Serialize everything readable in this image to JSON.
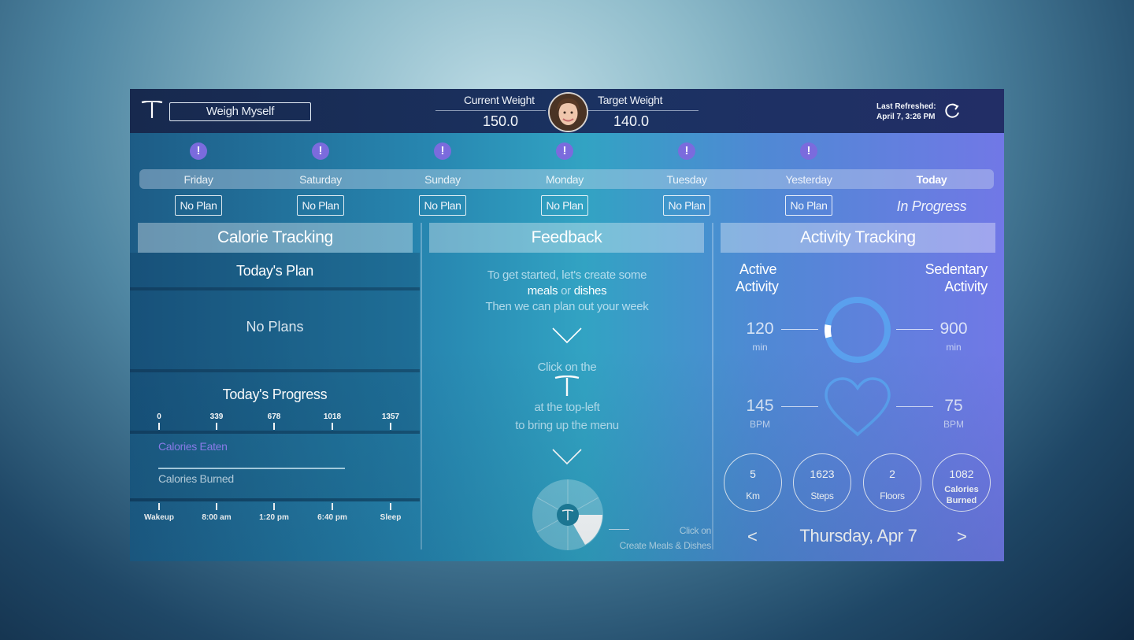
{
  "header": {
    "weigh_button": "Weigh Myself",
    "current_weight_label": "Current Weight",
    "current_weight_value": "150.0",
    "target_weight_label": "Target Weight",
    "target_weight_value": "140.0",
    "last_refreshed_label": "Last Refreshed:",
    "last_refreshed_value": "April 7, 3:26 PM"
  },
  "days": [
    {
      "label": "Friday",
      "status": "No Plan",
      "alert": "!"
    },
    {
      "label": "Saturday",
      "status": "No Plan",
      "alert": "!"
    },
    {
      "label": "Sunday",
      "status": "No Plan",
      "alert": "!"
    },
    {
      "label": "Monday",
      "status": "No Plan",
      "alert": "!"
    },
    {
      "label": "Tuesday",
      "status": "No Plan",
      "alert": "!"
    },
    {
      "label": "Yesterday",
      "status": "No Plan",
      "alert": "!"
    },
    {
      "label": "Today",
      "status": "In Progress"
    }
  ],
  "calorie": {
    "header": "Calorie Tracking",
    "todays_plan": "Today's Plan",
    "no_plans": "No Plans",
    "todays_progress": "Today's Progress",
    "scale": [
      "0",
      "339",
      "678",
      "1018",
      "1357"
    ],
    "calories_eaten_label": "Calories Eaten",
    "calories_burned_label": "Calories Burned",
    "calories_burned_value": 1082,
    "time_labels": [
      "Wakeup",
      "8:00 am",
      "1:20 pm",
      "6:40 pm",
      "Sleep"
    ]
  },
  "feedback": {
    "header": "Feedback",
    "line1": "To get started, let's create some",
    "meals": "meals",
    "or": "or",
    "dishes": "dishes",
    "line3": "Then we can plan out your week",
    "click_on_the": "Click on the",
    "at_top_left": "at the top-left",
    "bring_up_menu": "to bring up the menu",
    "click_on": "Click on",
    "create_meals": "Create Meals & Dishes"
  },
  "activity": {
    "header": "Activity Tracking",
    "active_label_1": "Active",
    "active_label_2": "Activity",
    "sedentary_label_1": "Sedentary",
    "sedentary_label_2": "Activity",
    "active_min": "120",
    "sedentary_min": "900",
    "min_unit": "min",
    "active_fraction": 0.12,
    "bpm_left": "145",
    "bpm_right": "75",
    "bpm_unit": "BPM",
    "stats": [
      {
        "value": "5",
        "unit": "Km"
      },
      {
        "value": "1623",
        "unit": "Steps"
      },
      {
        "value": "2",
        "unit": "Floors"
      },
      {
        "value": "1082",
        "unit_line1": "Calories",
        "unit_line2": "Burned"
      }
    ],
    "prev_arrow": "<",
    "next_arrow": ">",
    "date": "Thursday, Apr 7"
  },
  "colors": {
    "alert_badge": "#7b6bdd",
    "calories_eaten": "#8f7ff0",
    "ring_accent": "#5aa0ee"
  }
}
